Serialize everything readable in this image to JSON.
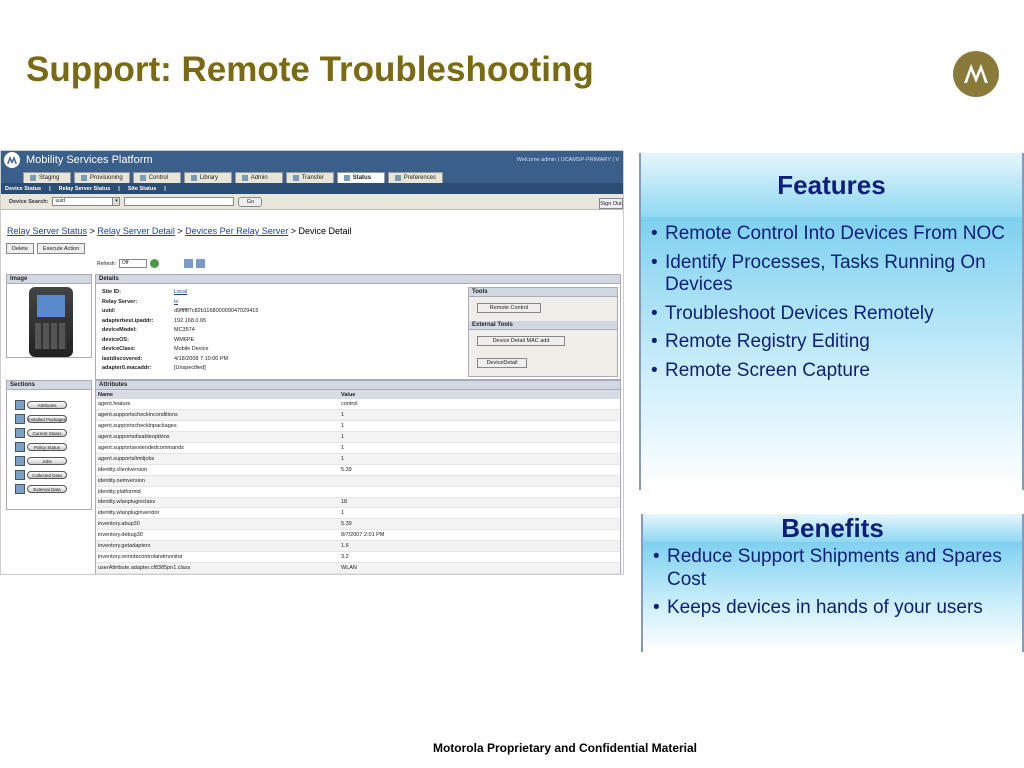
{
  "slide": {
    "title": "Support: Remote Troubleshooting",
    "footer": "Motorola Proprietary and Confidential Material"
  },
  "app": {
    "name": "Mobility Services Platform",
    "welcome": "Welcome admin | UCAMSP-PRIMARY | V",
    "tabs": [
      {
        "label": "Staging"
      },
      {
        "label": "Provisioning"
      },
      {
        "label": "Control"
      },
      {
        "label": "Library"
      },
      {
        "label": "Admin"
      },
      {
        "label": "Transfer"
      },
      {
        "label": "Status"
      },
      {
        "label": "Preferences"
      }
    ],
    "subnav": [
      "Device Status",
      "|",
      "Relay Server Status",
      "|",
      "Site Status",
      "|"
    ],
    "search": {
      "label": "Device Search:",
      "selected": "uuid",
      "go": "Go",
      "signout": "Sign Out"
    },
    "breadcrumb": {
      "items": [
        "Relay Server Status",
        "Relay Server Detail",
        "Devices Per Relay Server"
      ],
      "sep": ">",
      "current": "Device Detail"
    },
    "actions": {
      "delete": "Delete",
      "execute": "Execute Action"
    },
    "refresh": {
      "label": "Refresh:",
      "selected": "Off"
    },
    "image_panel": {
      "title": "Image"
    },
    "details": {
      "title": "Details",
      "rows": [
        {
          "k": "Site ID:",
          "v": "Local"
        },
        {
          "k": "Relay Server:",
          "v": "is"
        },
        {
          "k": "uuid:",
          "v": "d9ffffff7c82b116800009047029415"
        },
        {
          "k": "adapterbest.ipaddr:",
          "v": "192.168.0.65"
        },
        {
          "k": "deviceModel:",
          "v": "MC3574"
        },
        {
          "k": "deviceOS:",
          "v": "WM6PE"
        },
        {
          "k": "deviceClass:",
          "v": "Mobile Device"
        },
        {
          "k": "lastdiscovered:",
          "v": "4/18/2008 7:10:00 PM"
        },
        {
          "k": "adapter0.macaddr:",
          "v": "[Unspecified]"
        }
      ]
    },
    "tools": {
      "title": "Tools",
      "remote_control": "Remote Control",
      "external_title": "External Tools",
      "mac_add": "Device Detail MAC add",
      "device_detail": "DeviceDetail"
    },
    "sections": {
      "title": "Sections",
      "items": [
        "Attributes",
        "Installed Packages",
        "Current Status",
        "Policy Status",
        "Jobs",
        "Collected Data",
        "External Data"
      ]
    },
    "attributes": {
      "title": "Attributes",
      "headers": [
        "Name",
        "Value"
      ],
      "rows": [
        [
          "agent.feature",
          "control"
        ],
        [
          "agent.supportscheckinconditions",
          "1"
        ],
        [
          "agent.supportscheckinpackages",
          "1"
        ],
        [
          "agent.supportsdisableoptions",
          "1"
        ],
        [
          "agent.supportsextendedcommands",
          "1"
        ],
        [
          "agent.supportslimitjobs",
          "1"
        ],
        [
          "identity.clientversion",
          "5.39"
        ],
        [
          "identity.oemversion",
          ""
        ],
        [
          "identity.platformid",
          ""
        ],
        [
          "identity.wlanpluginclass",
          "18"
        ],
        [
          "identity.wlanpluginvendor",
          "1"
        ],
        [
          "inventory.abup30",
          "5.39"
        ],
        [
          "inventory.debug30",
          "8/7/2007 2:01 PM"
        ],
        [
          "inventory.getadapters",
          "1.6"
        ],
        [
          "inventory.remotecontrolandmonitor",
          "3.2"
        ],
        [
          "userAttribute.adapter.cf8385pn1.class",
          "WLAN"
        ]
      ]
    }
  },
  "features": {
    "title": "Features",
    "items": [
      "Remote Control Into Devices From NOC",
      "Identify Processes, Tasks Running On Devices",
      "Troubleshoot Devices Remotely",
      "Remote Registry Editing",
      "Remote Screen Capture"
    ]
  },
  "benefits": {
    "title": "Benefits",
    "items": [
      "Reduce Support Shipments and Spares Cost",
      "Keeps devices in hands of your users"
    ]
  },
  "colors": {
    "title": "#7b6a14",
    "feature_text": "#0d1f7a",
    "app_header": "#3a5f8a"
  }
}
